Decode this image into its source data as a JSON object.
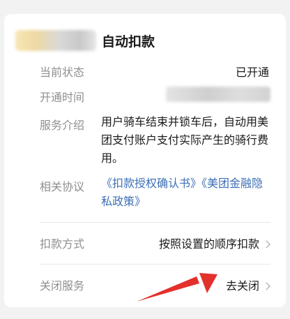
{
  "header": {
    "title": "自动扣款"
  },
  "details": {
    "status_label": "当前状态",
    "status_value": "已开通",
    "opened_time_label": "开通时间",
    "service_label": "服务介绍",
    "service_desc": "用户骑车结束并锁车后，自动用美团支付账户支付实际产生的骑行费用。",
    "agreement_label": "相关协议",
    "agreements": [
      "《扣款授权确认书》",
      "《美团金融隐私政策》"
    ]
  },
  "payment": {
    "method_label": "扣款方式",
    "method_value": "按照设置的顺序扣款"
  },
  "close": {
    "label": "关闭服务",
    "action": "去关闭"
  },
  "colors": {
    "link": "#3d6fb6",
    "annotation_arrow": "#e3302b"
  },
  "icons": [
    "chevron-right-icon",
    "annotation-arrow"
  ]
}
